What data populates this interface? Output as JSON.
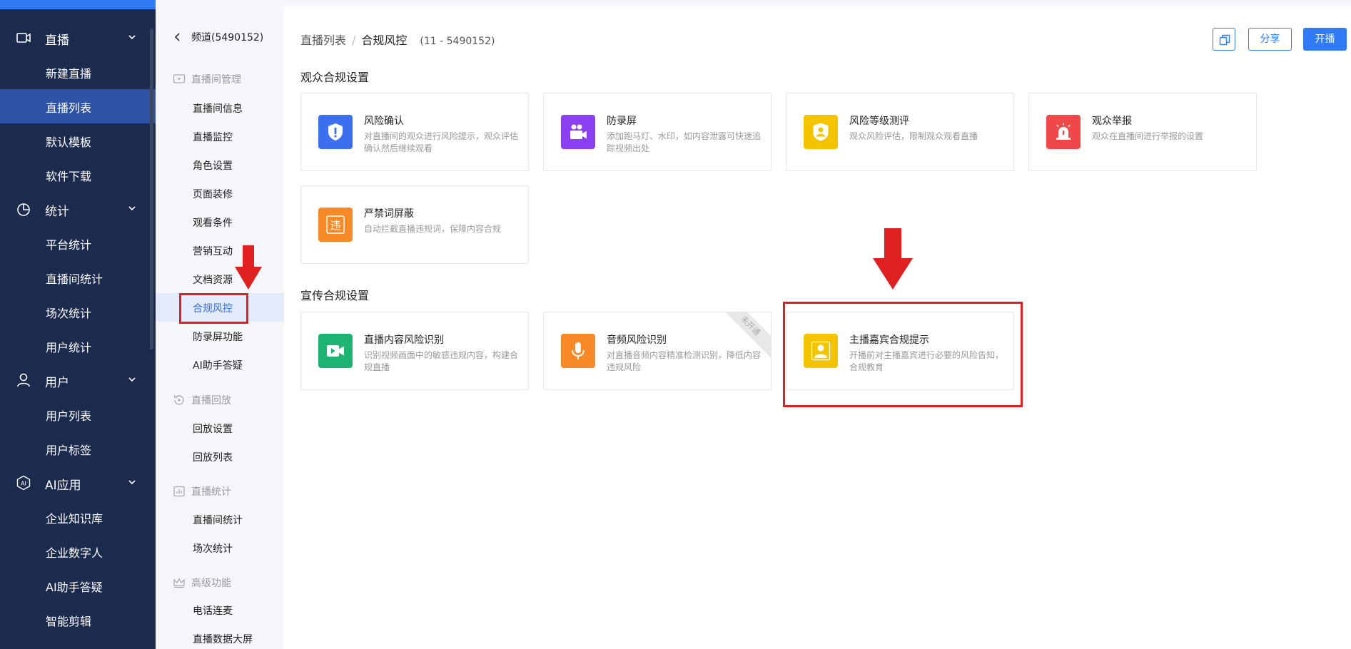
{
  "sidebar": {
    "groups": [
      {
        "label": "直播",
        "icon": "video-camera-icon",
        "items": [
          "新建直播",
          "直播列表",
          "默认模板",
          "软件下载"
        ]
      },
      {
        "label": "统计",
        "icon": "pie-chart-icon",
        "items": [
          "平台统计",
          "直播间统计",
          "场次统计",
          "用户统计"
        ]
      },
      {
        "label": "用户",
        "icon": "user-icon",
        "items": [
          "用户列表",
          "用户标签"
        ]
      },
      {
        "label": "AI应用",
        "icon": "ai-icon",
        "items": [
          "企业知识库",
          "企业数字人",
          "AI助手答疑",
          "智能剪辑"
        ]
      }
    ],
    "active_item": "直播列表"
  },
  "sub": {
    "back_label": "频道(5490152)",
    "sections": [
      {
        "label": "直播间管理",
        "icon": "monitor-play-icon",
        "items": [
          "直播间信息",
          "直播监控",
          "角色设置",
          "页面装修",
          "观看条件",
          "营销互动",
          "文档资源",
          "合规风控",
          "防录屏功能",
          "AI助手答疑"
        ]
      },
      {
        "label": "直播回放",
        "icon": "replay-icon",
        "items": [
          "回放设置",
          "回放列表"
        ]
      },
      {
        "label": "直播统计",
        "icon": "bar-chart-icon",
        "items": [
          "直播间统计",
          "场次统计"
        ]
      },
      {
        "label": "高级功能",
        "icon": "crown-icon",
        "items": [
          "电话连麦",
          "直播数据大屏"
        ]
      }
    ],
    "active_item": "合规风控"
  },
  "breadcrumb": {
    "parent": "直播列表",
    "separator": "/",
    "current": "合规风控",
    "id_text": "(11 - 5490152)"
  },
  "toolbar": {
    "share_label": "分享",
    "start_label": "开播",
    "copy_icon": "copy-icon"
  },
  "sections": [
    {
      "title": "观众合规设置",
      "cards": [
        {
          "title": "风险确认",
          "desc": "对直播间的观众进行风险提示，观众评估确认然后继续观看",
          "icon": "shield-alert-icon",
          "color": "#3b6ff0"
        },
        {
          "title": "防录屏",
          "desc": "添加跑马灯、水印，如内容泄露可快速追踪视频出处",
          "icon": "camera-people-icon",
          "color": "#8a3ff0"
        },
        {
          "title": "风险等级测评",
          "desc": "观众风险评估，限制观众观看直播",
          "icon": "user-badge-icon",
          "color": "#f5c400"
        },
        {
          "title": "观众举报",
          "desc": "观众在直播间进行举报的设置",
          "icon": "alarm-icon",
          "color": "#f04848"
        },
        {
          "title": "严禁词屏蔽",
          "desc": "自动拦截直播违规词，保障内容合规",
          "icon": "forbidden-word-icon",
          "glyph": "违",
          "color": "#f78a26"
        }
      ]
    },
    {
      "title": "宣传合规设置",
      "cards": [
        {
          "title": "直播内容风险识别",
          "desc": "识别视频画面中的敏感违规内容，构建合规直播",
          "icon": "video-icon",
          "color": "#1db371"
        },
        {
          "title": "音频风险识别",
          "desc": "对直播音频内容精准检测识别，降低内容违规风险",
          "icon": "microphone-icon",
          "color": "#f78a26",
          "ribbon": "未开通"
        },
        {
          "title": "主播嘉宾合规提示",
          "desc": "开播前对主播嘉宾进行必要的风险告知，合规教育",
          "icon": "host-person-icon",
          "color": "#f5c400"
        }
      ]
    }
  ],
  "colors": {
    "accent": "#2f7bf5",
    "sidebar_bg": "#1b2a4d",
    "highlight": "#e02020"
  }
}
